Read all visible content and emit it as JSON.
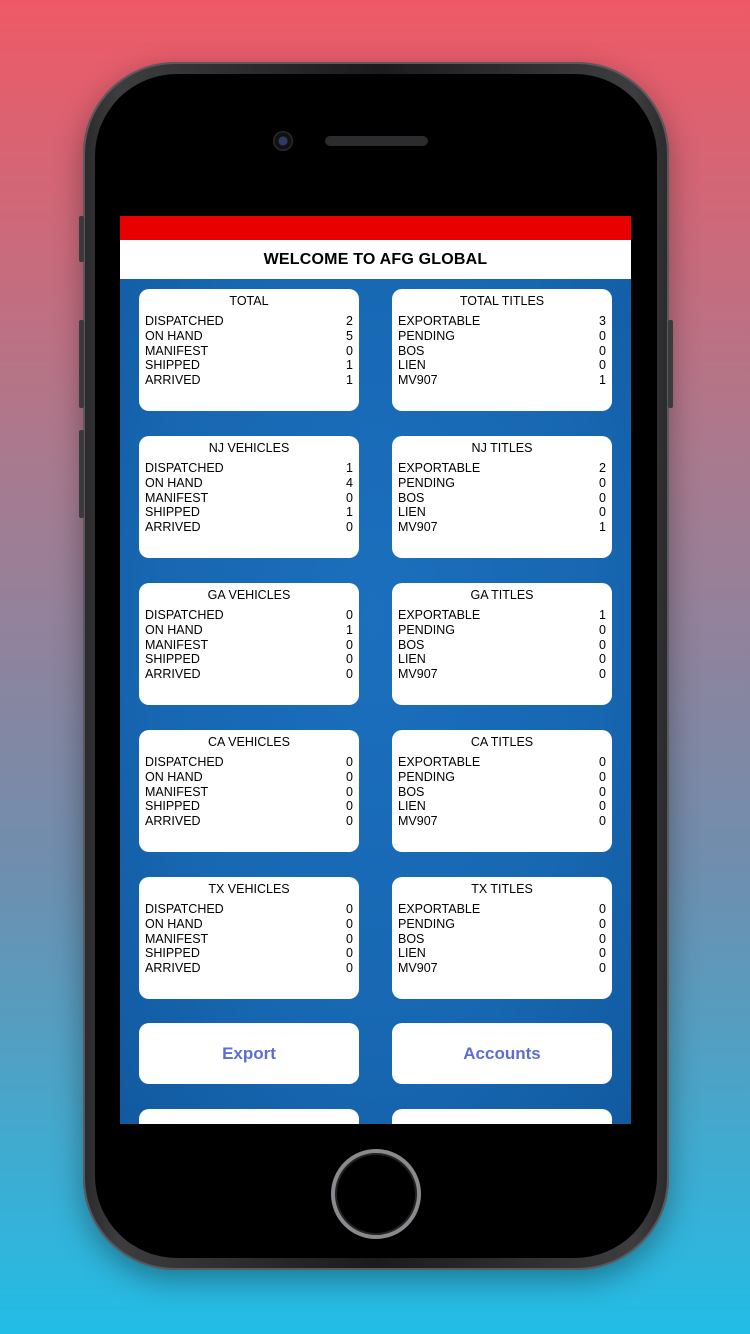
{
  "header": {
    "title": "WELCOME TO AFG GLOBAL"
  },
  "cards": [
    {
      "title": "TOTAL",
      "rows": [
        {
          "label": "DISPATCHED",
          "value": "2"
        },
        {
          "label": "ON HAND",
          "value": "5"
        },
        {
          "label": "MANIFEST",
          "value": "0"
        },
        {
          "label": "SHIPPED",
          "value": "1"
        },
        {
          "label": "ARRIVED",
          "value": "1"
        }
      ]
    },
    {
      "title": "TOTAL TITLES",
      "rows": [
        {
          "label": "EXPORTABLE",
          "value": "3"
        },
        {
          "label": "PENDING",
          "value": "0"
        },
        {
          "label": "BOS",
          "value": "0"
        },
        {
          "label": "LIEN",
          "value": "0"
        },
        {
          "label": "MV907",
          "value": "1"
        }
      ]
    },
    {
      "title": "NJ VEHICLES",
      "rows": [
        {
          "label": "DISPATCHED",
          "value": "1"
        },
        {
          "label": "ON HAND",
          "value": "4"
        },
        {
          "label": "MANIFEST",
          "value": "0"
        },
        {
          "label": "SHIPPED",
          "value": "1"
        },
        {
          "label": "ARRIVED",
          "value": "0"
        }
      ]
    },
    {
      "title": "NJ TITLES",
      "rows": [
        {
          "label": "EXPORTABLE",
          "value": "2"
        },
        {
          "label": "PENDING",
          "value": "0"
        },
        {
          "label": "BOS",
          "value": "0"
        },
        {
          "label": "LIEN",
          "value": "0"
        },
        {
          "label": "MV907",
          "value": "1"
        }
      ]
    },
    {
      "title": "GA VEHICLES",
      "rows": [
        {
          "label": "DISPATCHED",
          "value": "0"
        },
        {
          "label": "ON HAND",
          "value": "1"
        },
        {
          "label": "MANIFEST",
          "value": "0"
        },
        {
          "label": "SHIPPED",
          "value": "0"
        },
        {
          "label": "ARRIVED",
          "value": "0"
        }
      ]
    },
    {
      "title": "GA TITLES",
      "rows": [
        {
          "label": "EXPORTABLE",
          "value": "1"
        },
        {
          "label": "PENDING",
          "value": "0"
        },
        {
          "label": "BOS",
          "value": "0"
        },
        {
          "label": "LIEN",
          "value": "0"
        },
        {
          "label": "MV907",
          "value": "0"
        }
      ]
    },
    {
      "title": "CA VEHICLES",
      "rows": [
        {
          "label": "DISPATCHED",
          "value": "0"
        },
        {
          "label": "ON HAND",
          "value": "0"
        },
        {
          "label": "MANIFEST",
          "value": "0"
        },
        {
          "label": "SHIPPED",
          "value": "0"
        },
        {
          "label": "ARRIVED",
          "value": "0"
        }
      ]
    },
    {
      "title": "CA TITLES",
      "rows": [
        {
          "label": "EXPORTABLE",
          "value": "0"
        },
        {
          "label": "PENDING",
          "value": "0"
        },
        {
          "label": "BOS",
          "value": "0"
        },
        {
          "label": "LIEN",
          "value": "0"
        },
        {
          "label": "MV907",
          "value": "0"
        }
      ]
    },
    {
      "title": "TX VEHICLES",
      "rows": [
        {
          "label": "DISPATCHED",
          "value": "0"
        },
        {
          "label": "ON HAND",
          "value": "0"
        },
        {
          "label": "MANIFEST",
          "value": "0"
        },
        {
          "label": "SHIPPED",
          "value": "0"
        },
        {
          "label": "ARRIVED",
          "value": "0"
        }
      ]
    },
    {
      "title": "TX TITLES",
      "rows": [
        {
          "label": "EXPORTABLE",
          "value": "0"
        },
        {
          "label": "PENDING",
          "value": "0"
        },
        {
          "label": "BOS",
          "value": "0"
        },
        {
          "label": "LIEN",
          "value": "0"
        },
        {
          "label": "MV907",
          "value": "0"
        }
      ]
    }
  ],
  "buttons": {
    "export": "Export",
    "accounts": "Accounts"
  },
  "colors": {
    "header_red": "#e80000",
    "content_blue": "#1a6bb6",
    "button_text": "#5b6fd0"
  }
}
